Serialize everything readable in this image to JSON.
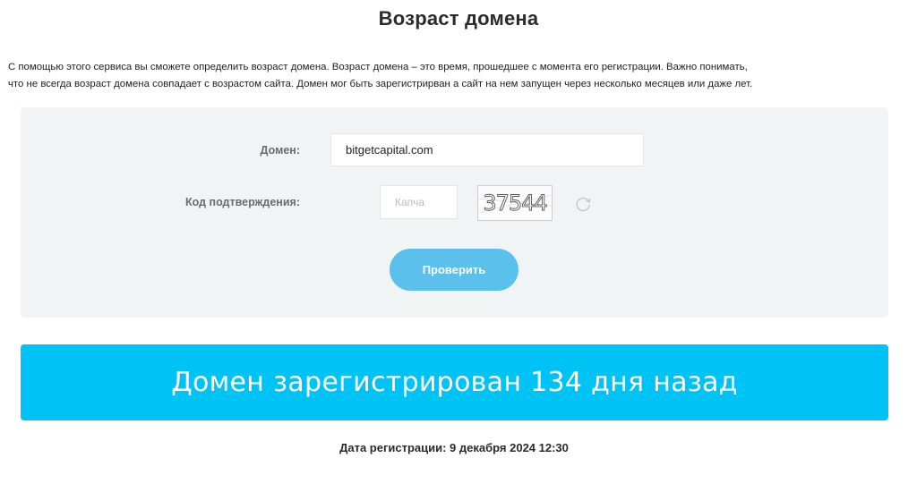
{
  "page": {
    "title": "Возраст домена",
    "intro_line1": "С помощью этого сервиса вы сможете определить возраст домена. Возраст домена – это время, прошедшее с момента его регистрации. Важно понимать,",
    "intro_line2": "что не всегда возраст домена совпадает с возрастом сайта. Домен мог быть зарегистрирван а сайт на нем запущен через несколько месяцев или даже лет."
  },
  "form": {
    "domain_label": "Домен:",
    "domain_value": "bitgetcapital.com",
    "captcha_label": "Код подтверждения:",
    "captcha_placeholder": "Капча",
    "captcha_image_text": "37544",
    "refresh_icon": "refresh-icon",
    "submit_label": "Проверить"
  },
  "result": {
    "message": "Домен зарегистрирован 134 дня назад",
    "registration_date": "Дата регистрации: 9 декабря 2024 12:30"
  },
  "colors": {
    "panel_bg": "#f1f4f4",
    "button_bg": "#5bc0eb",
    "banner_bg": "#00c3f5",
    "text_dark": "#2b2b2b"
  }
}
